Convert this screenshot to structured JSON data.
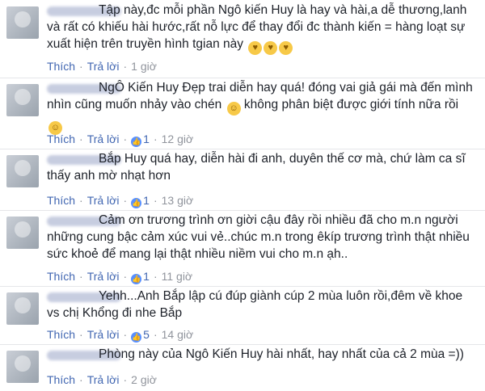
{
  "comments": [
    {
      "text": "Tập này,đc mỗi phần Ngô kiến Huy là hay và hài,a dễ thương,lanh và rất có khiếu hài hước,rất nỗ lực để thay đổi đc thành kiến = hàng loạt sự xuất hiện trên truyền hình tgian này",
      "emojis": [
        "kiss-emoji",
        "kiss-emoji",
        "kiss-emoji"
      ],
      "like_label": "Thích",
      "reply_label": "Trả lời",
      "likes": "",
      "time": "1 giờ"
    },
    {
      "text": "NgÔ Kiến Huy Đẹp trai diễn hay quá! đóng vai giả gái mà đến mình nhìn cũng muốn nhảy vào chén",
      "text2": "không phân biệt được giới tính nữa rồi",
      "emojis": [
        "tongue-emoji",
        "smile-emoji"
      ],
      "like_label": "Thích",
      "reply_label": "Trả lời",
      "likes": "1",
      "time": "12 giờ"
    },
    {
      "text": "Bắp Huy quá hay, diễn hài đi anh, duyên thế cơ mà, chứ làm ca sĩ thấy anh mờ nhạt hơn",
      "like_label": "Thích",
      "reply_label": "Trả lời",
      "likes": "1",
      "time": "13 giờ"
    },
    {
      "text": "Cảm ơn trương trình ơn giời cậu đây rồi nhiều đã cho m.n người những cung bậc cảm xúc vui vẻ..chúc m.n trong êkíp trương trình thật nhiều sức khoẻ để mang lại thật nhiều niềm vui cho m.n ạh..",
      "like_label": "Thích",
      "reply_label": "Trả lời",
      "likes": "1",
      "time": "11 giờ"
    },
    {
      "text": "Yehh...Anh Bắp lập cú đúp giành cúp 2 mùa luôn rồi,đêm về khoe vs chị Khổng đi nhe Bắp",
      "like_label": "Thích",
      "reply_label": "Trả lời",
      "likes": "5",
      "time": "14 giờ"
    },
    {
      "text": "Phòng này của Ngô Kiến Huy hài nhất, hay nhất của cả 2 mùa =))",
      "like_label": "Thích",
      "reply_label": "Trả lời",
      "likes": "",
      "time": "2 giờ"
    }
  ]
}
